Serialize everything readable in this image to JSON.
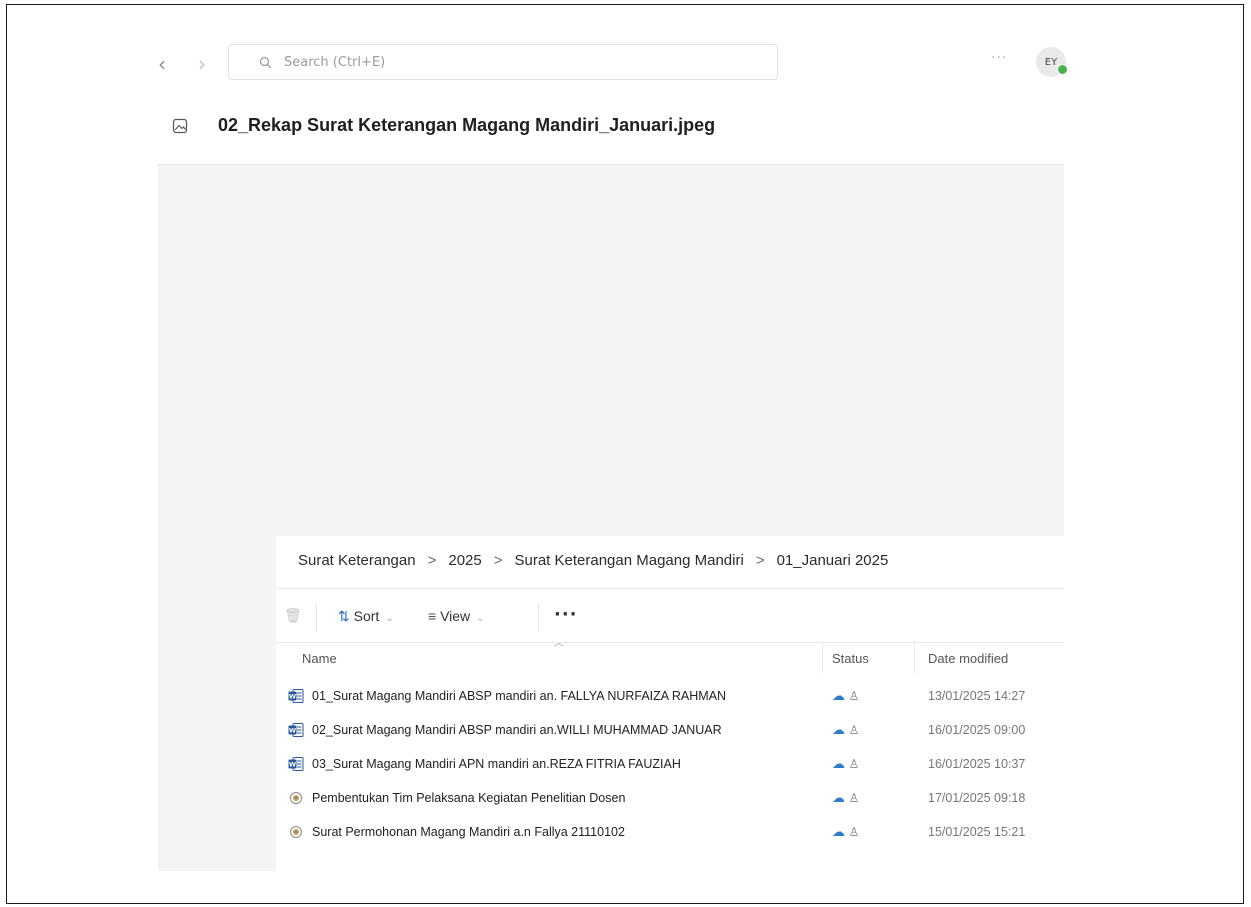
{
  "topbar": {
    "search_placeholder": "Search (Ctrl+E)",
    "more_label": "···",
    "avatar_initials": "EY"
  },
  "viewer": {
    "file_title": "02_Rekap Surat Keterangan Magang Mandiri_Januari.jpeg"
  },
  "explorer": {
    "breadcrumb": [
      "Surat Keterangan",
      "2025",
      "Surat Keterangan Magang Mandiri",
      "01_Januari 2025"
    ],
    "toolbar": {
      "sort_label": "Sort",
      "view_label": "View",
      "more_label": "···"
    },
    "columns": {
      "name": "Name",
      "status": "Status",
      "date_modified": "Date modified"
    },
    "files": [
      {
        "name": "01_Surat Magang Mandiri ABSP mandiri an. FALLYA NURFAIZA RAHMAN",
        "type": "word",
        "date": "13/01/2025 14:27"
      },
      {
        "name": "02_Surat Magang Mandiri ABSP mandiri an.WILLI MUHAMMAD JANUAR",
        "type": "word",
        "date": "16/01/2025 09:00"
      },
      {
        "name": "03_Surat Magang Mandiri APN mandiri an.REZA FITRIA FAUZIAH",
        "type": "word",
        "date": "16/01/2025 10:37"
      },
      {
        "name": "Pembentukan Tim Pelaksana Kegiatan Penelitian Dosen",
        "type": "pdf",
        "date": "17/01/2025 09:18"
      },
      {
        "name": "Surat Permohonan Magang Mandiri a.n Fallya 21110102",
        "type": "pdf",
        "date": "15/01/2025 15:21"
      }
    ],
    "colors": {
      "word_icon": "#2b579a",
      "cloud_status": "#2f7dc9"
    }
  }
}
